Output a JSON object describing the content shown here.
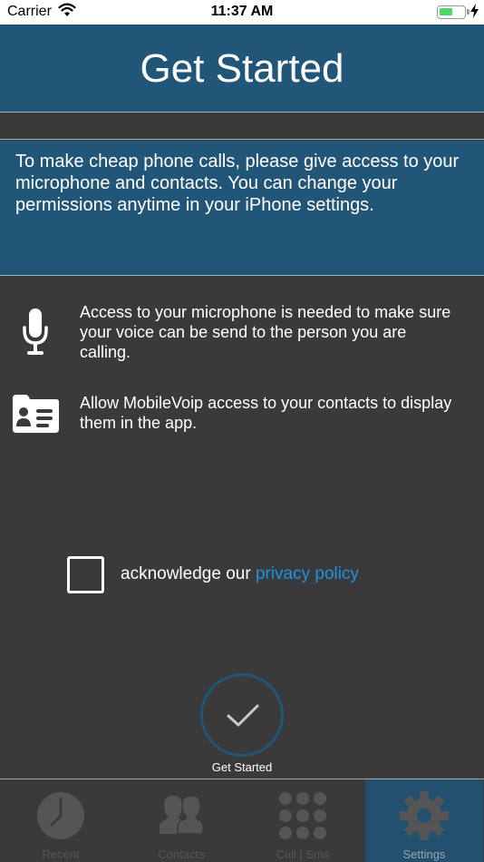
{
  "status_bar": {
    "carrier": "Carrier",
    "time": "11:37 AM",
    "battery_level": 0.55
  },
  "header": {
    "title": "Get Started"
  },
  "intro": {
    "text": "To make cheap phone calls, please give access to your microphone and contacts. You can change your permissions anytime in your iPhone settings."
  },
  "permissions": {
    "microphone": {
      "icon": "microphone-icon",
      "text": "Access to your microphone is needed to make sure your voice can be send to the person you are calling."
    },
    "contacts": {
      "icon": "contact-card-icon",
      "text": "Allow MobileVoip access to your contacts to display them in the app."
    }
  },
  "acknowledge": {
    "checked": false,
    "label": "acknowledge our ",
    "link_text": "privacy policy"
  },
  "start_button": {
    "label": "Get Started",
    "icon": "checkmark-icon"
  },
  "tabs": [
    {
      "label": "Recent",
      "icon": "clock-icon",
      "active": false
    },
    {
      "label": "Contacts",
      "icon": "people-icon",
      "active": false
    },
    {
      "label": "Call | Sms",
      "icon": "keypad-icon",
      "active": false
    },
    {
      "label": "Settings",
      "icon": "gear-icon",
      "active": true
    }
  ],
  "colors": {
    "header_blue": "#225678",
    "background": "#3a3a3b",
    "link": "#1b93e6",
    "battery": "#4cd964"
  }
}
